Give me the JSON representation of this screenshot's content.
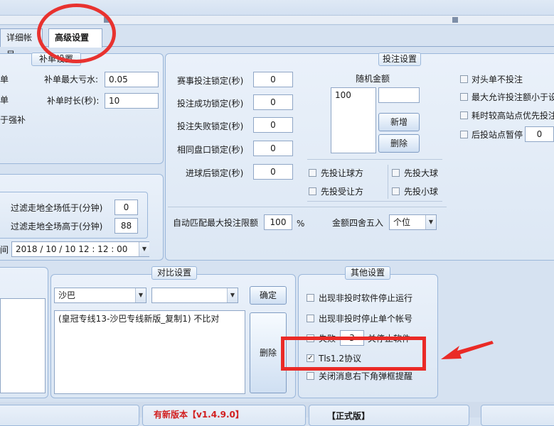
{
  "tabs": {
    "detail": "详细帐目",
    "advanced": "高级设置"
  },
  "supplement": {
    "title": "补单设置",
    "left_frag1": "单",
    "left_frag2": "单",
    "left_frag3": "于强补",
    "max_loss_label": "补单最大亏水:",
    "max_loss_value": "0.05",
    "duration_label": "补单时长(秒):",
    "duration_value": "10"
  },
  "filter": {
    "below_label": "过滤走地全场低于(分钟)",
    "below_value": "0",
    "above_label": "过滤走地全场高于(分钟)",
    "above_value": "88",
    "time_frag": "间",
    "datetime_value": "2018 / 10 / 10    12 : 12 : 00"
  },
  "bet": {
    "title": "投注设置",
    "event_lock_label": "赛事投注锁定(秒)",
    "event_lock_value": "0",
    "success_lock_label": "投注成功锁定(秒)",
    "success_lock_value": "0",
    "fail_lock_label": "投注失败锁定(秒)",
    "fail_lock_value": "0",
    "same_odds_lock_label": "相同盘口锁定(秒)",
    "same_odds_lock_value": "0",
    "goal_lock_label": "进球后锁定(秒)",
    "goal_lock_value": "0",
    "random_amount_label": "随机金额",
    "random_list": [
      "100"
    ],
    "add_button": "新增",
    "delete_button": "删除",
    "first_give_label": "先投让球方",
    "first_big_label": "先投大球",
    "first_receive_label": "先投受让方",
    "first_small_label": "先投小球",
    "auto_limit_label": "自动匹配最大投注限额",
    "auto_limit_value": "100",
    "percent_sign": "%",
    "rounding_label": "金额四舍五入",
    "rounding_value": "个位",
    "opponent_no_bet": "对头单不投注",
    "max_allowed_bet": "最大允许投注额小于设",
    "prefer_high_site": "耗时较高站点优先投注",
    "pause_label": "后投站点暂停",
    "pause_value": "0"
  },
  "compare": {
    "title": "对比设置",
    "select1_value": "沙巴",
    "select2_value": "",
    "confirm_button": "确定",
    "list_item": "(皇冠专线13-沙巴专线新版_复制1) 不比对",
    "delete_button": "删除"
  },
  "other": {
    "title": "其他设置",
    "stop_software_label": "出现非投时软件停止运行",
    "stop_account_label": "出现非投时停止单个帐号",
    "fail_prefix": "失败",
    "fail_value": "3",
    "fail_suffix": "关停止软件",
    "tls_label": "Tls1.2协议",
    "close_popup_label": "关闭消息右下角弹框提醒"
  },
  "footer": {
    "new_version": "有新版本【v1.4.9.0】",
    "formal": "【正式版】"
  },
  "colors": {
    "annotation_red": "#ea2a26",
    "accent_blue": "#9bb7da"
  }
}
